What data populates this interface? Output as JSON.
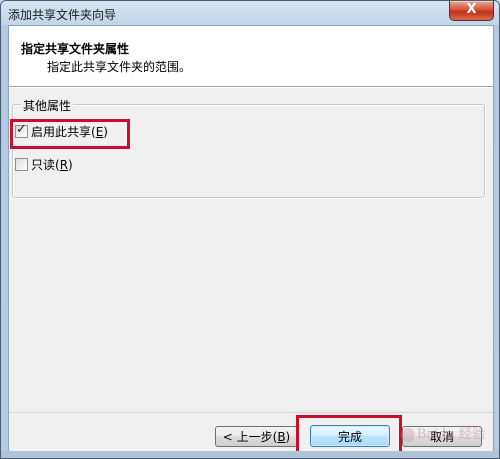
{
  "window": {
    "title": "添加共享文件夹向导",
    "close_glyph": "X"
  },
  "header": {
    "title": "指定共享文件夹属性",
    "subtitle": "指定此共享文件夹的范围。"
  },
  "group": {
    "label": "其他属性",
    "options": [
      {
        "label": "启用此共享",
        "mnemonic": "E",
        "checked": true,
        "highlighted": true
      },
      {
        "label": "只读",
        "mnemonic": "R",
        "checked": false,
        "highlighted": false
      }
    ]
  },
  "buttons": {
    "back": {
      "prefix": "< 上一步(",
      "mnemonic": "B",
      "suffix": ")"
    },
    "finish": {
      "label": "完成",
      "highlighted": true,
      "is_default": true
    },
    "cancel": {
      "label": "取消"
    }
  },
  "colors": {
    "highlight": "#c8102e",
    "close_button": "#c2301c"
  },
  "watermark": {
    "text": "Baidu 经验",
    "logo": "paw-icon"
  }
}
